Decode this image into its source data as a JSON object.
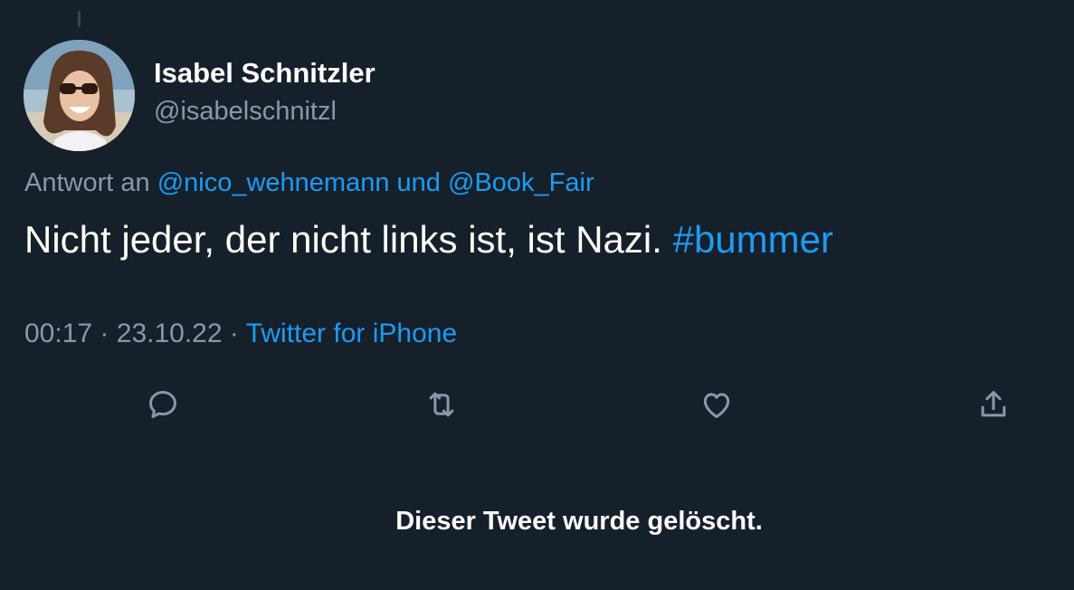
{
  "author": {
    "display_name": "Isabel Schnitzler",
    "handle": "@isabelschnitzl"
  },
  "reply": {
    "prefix": "Antwort an",
    "user1": "@nico_wehnemann",
    "connector": "und",
    "user2": "@Book_Fair"
  },
  "tweet": {
    "text": "Nicht jeder, der nicht links ist, ist Nazi.",
    "hashtag": "#bummer"
  },
  "meta": {
    "time": "00:17",
    "date": "23.10.22",
    "separator": "·",
    "source": "Twitter for iPhone"
  },
  "actions": [
    {
      "icon": "reply-icon"
    },
    {
      "icon": "retweet-icon"
    },
    {
      "icon": "like-icon"
    },
    {
      "icon": "share-icon"
    }
  ],
  "deleted_notice": "Dieser Tweet wurde gelöscht.",
  "colors": {
    "background": "#15202b",
    "link": "#1d9bf0",
    "secondary_text": "#8b98a5",
    "icon": "#8b98a5"
  }
}
